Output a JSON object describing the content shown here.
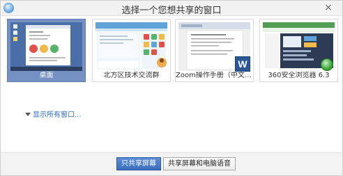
{
  "dialog": {
    "title": "选择一个您想共享的窗口",
    "close_label": "×"
  },
  "windows": [
    {
      "caption": "桌面",
      "selected": true
    },
    {
      "caption": "北方区技术交流群",
      "selected": false
    },
    {
      "caption": "Zoom操作手册（中文界面...",
      "selected": false
    },
    {
      "caption": "360安全浏览器 6.3",
      "selected": false
    }
  ],
  "show_all": {
    "label": "显示所有窗口..."
  },
  "footer": {
    "share_screen_only": "只共享屏幕",
    "share_screen_and_audio": "共享屏幕和电脑语音"
  },
  "colors": {
    "selected_bg": "#7590c2",
    "primary_button": "#3b6cbc",
    "link": "#2f6fba",
    "word_icon": "#2b5797",
    "browser_green": "#3aa535"
  }
}
